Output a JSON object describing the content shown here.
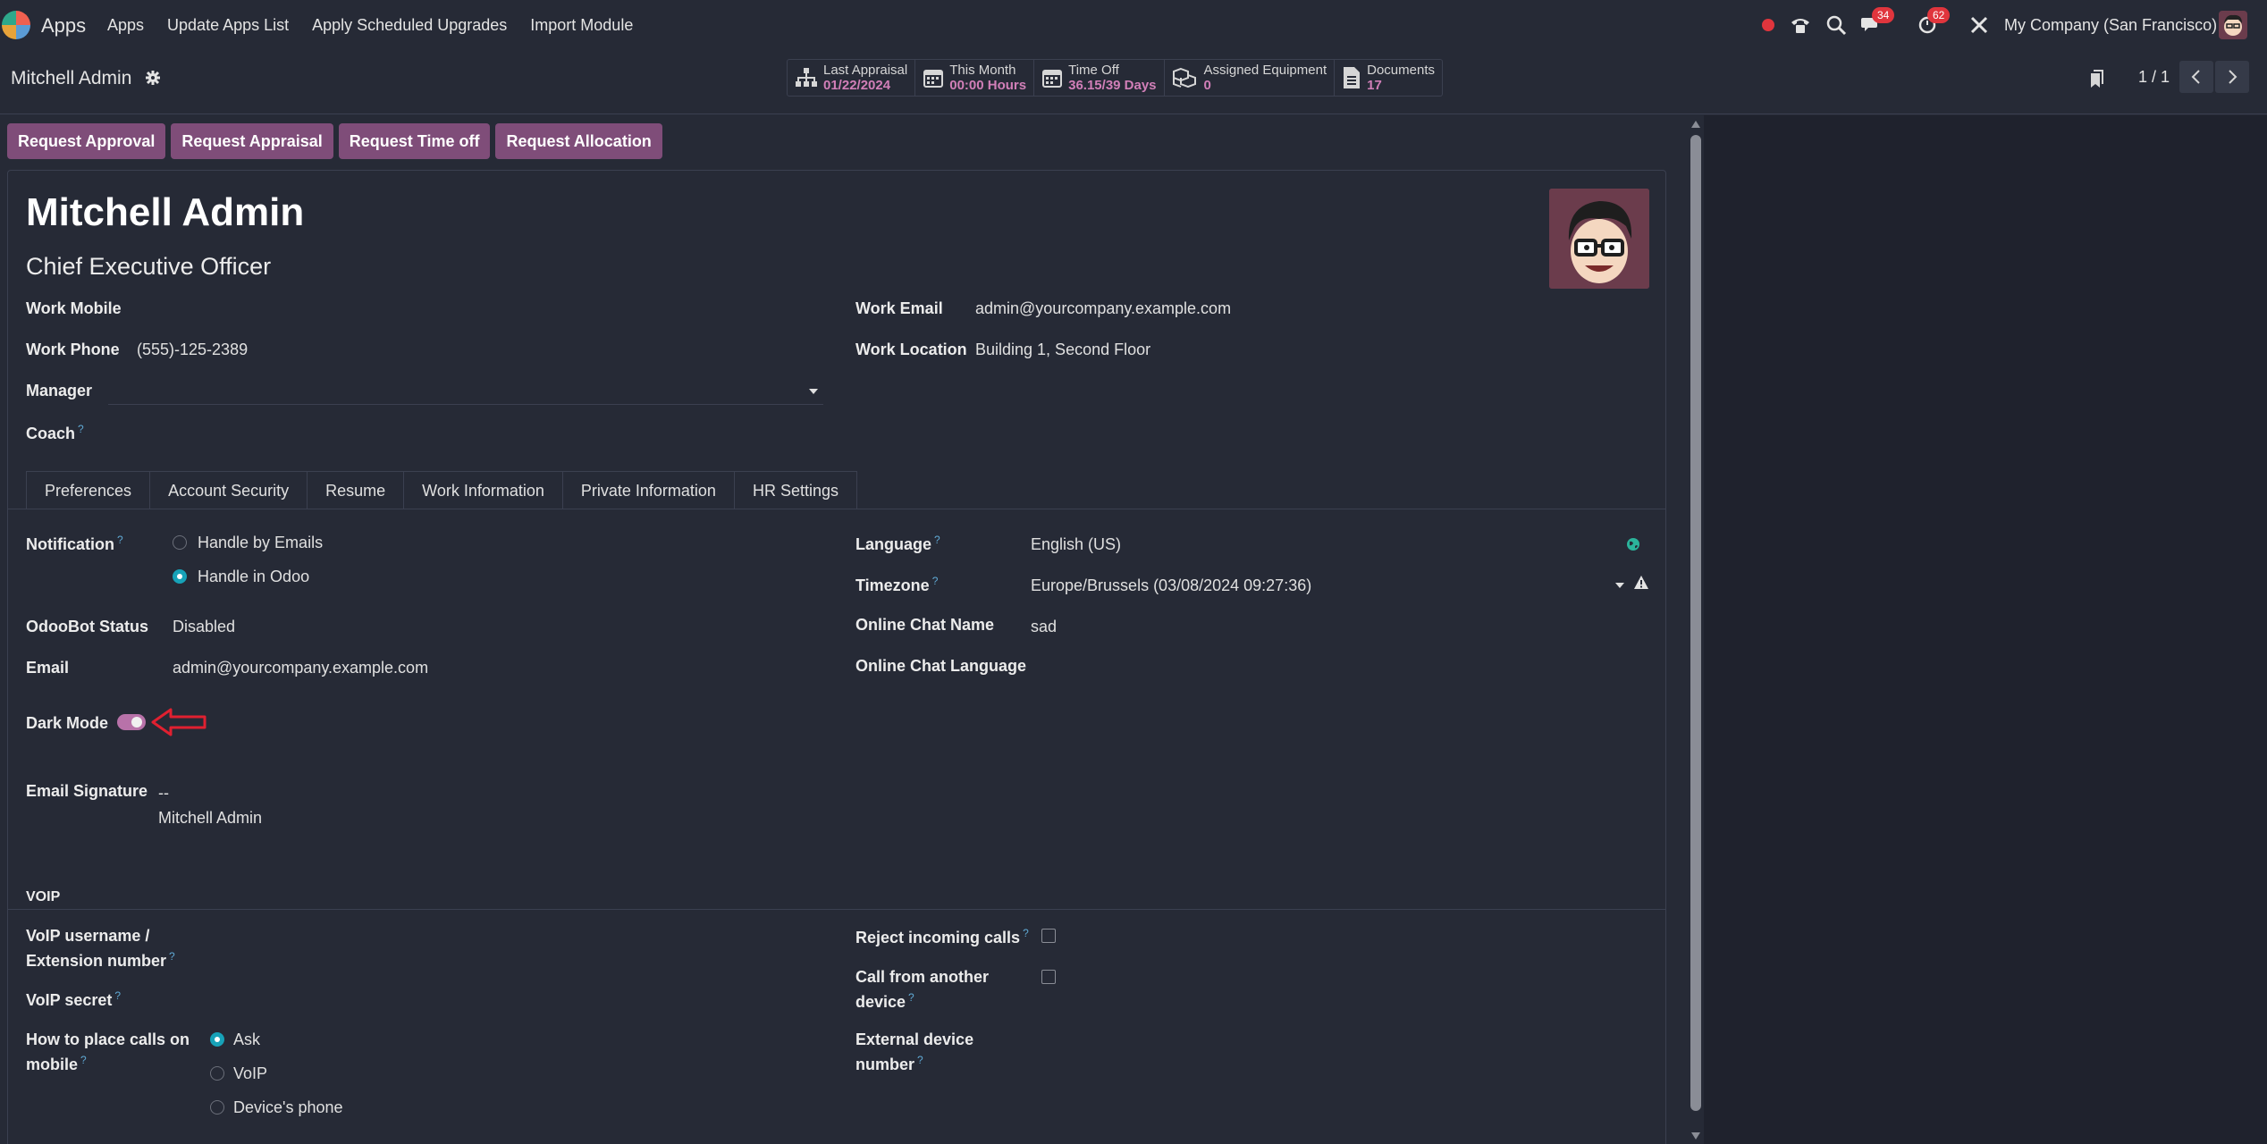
{
  "navbar": {
    "brand": "Apps",
    "menu": [
      "Apps",
      "Update Apps List",
      "Apply Scheduled Upgrades",
      "Import Module"
    ],
    "messages_badge": "34",
    "activities_badge": "62",
    "company": "My Company (San Francisco)"
  },
  "control_panel": {
    "title": "Mitchell Admin",
    "stats": [
      {
        "label": "Last Appraisal",
        "value": "01/22/2024",
        "icon": "sitemap-icon"
      },
      {
        "label": "This Month",
        "value": "00:00 Hours",
        "icon": "calendar-icon"
      },
      {
        "label": "Time Off",
        "value": "36.15/39 Days",
        "icon": "calendar-icon"
      },
      {
        "label": "Assigned Equipment",
        "value": "0",
        "icon": "cubes-icon"
      },
      {
        "label": "Documents",
        "value": "17",
        "icon": "file-icon"
      }
    ],
    "pager": "1 / 1"
  },
  "actions": [
    "Request Approval",
    "Request Appraisal",
    "Request Time off",
    "Request Allocation"
  ],
  "employee": {
    "name": "Mitchell Admin",
    "job_title": "Chief Executive Officer",
    "work_mobile_label": "Work Mobile",
    "work_phone_label": "Work Phone",
    "work_phone": "(555)-125-2389",
    "manager_label": "Manager",
    "coach_label": "Coach",
    "work_email_label": "Work Email",
    "work_email": "admin@yourcompany.example.com",
    "work_location_label": "Work Location",
    "work_location": "Building 1, Second Floor"
  },
  "tabs": [
    "Preferences",
    "Account Security",
    "Resume",
    "Work Information",
    "Private Information",
    "HR Settings"
  ],
  "preferences": {
    "notification_label": "Notification",
    "notification_options": [
      "Handle by Emails",
      "Handle in Odoo"
    ],
    "notification_selected": "Handle in Odoo",
    "odoobot_label": "OdooBot Status",
    "odoobot_value": "Disabled",
    "email_label": "Email",
    "email_value": "admin@yourcompany.example.com",
    "dark_mode_label": "Dark Mode",
    "dark_mode_on": true,
    "signature_label": "Email Signature",
    "signature_line1": "--",
    "signature_line2": "Mitchell Admin",
    "language_label": "Language",
    "language_value": "English (US)",
    "timezone_label": "Timezone",
    "timezone_value": "Europe/Brussels (03/08/2024 09:27:36)",
    "chat_name_label": "Online Chat Name",
    "chat_name_value": "sad",
    "chat_language_label": "Online Chat Language"
  },
  "voip": {
    "section_title": "VOIP",
    "username_label_1": "VoIP username /",
    "username_label_2": "Extension number",
    "secret_label": "VoIP secret",
    "calls_label_1": "How to place calls on",
    "calls_label_2": "mobile",
    "call_options": [
      "Ask",
      "VoIP",
      "Device's phone"
    ],
    "call_selected": "Ask",
    "reject_label": "Reject incoming calls",
    "another_label_1": "Call from another",
    "another_label_2": "device",
    "external_label_1": "External device",
    "external_label_2": "number"
  },
  "colors": {
    "accent": "#7f4d79",
    "stat_value": "#d17fb8",
    "radio_on": "#17a2b8",
    "badge": "#e0353d",
    "arrow": "#e02030"
  }
}
